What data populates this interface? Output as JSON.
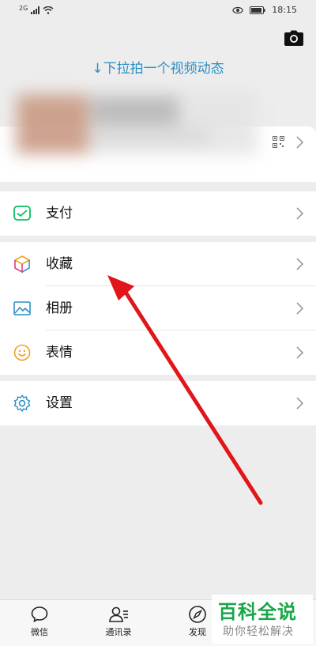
{
  "status_bar": {
    "network": "2G",
    "time": "18:15"
  },
  "header": {
    "pull_hint": "↓下拉拍一个视频动态"
  },
  "menu": {
    "pay": "支付",
    "favorites": "收藏",
    "album": "相册",
    "stickers": "表情",
    "settings": "设置"
  },
  "tabs": [
    {
      "label": "微信"
    },
    {
      "label": "通讯录"
    },
    {
      "label": "发现"
    }
  ],
  "watermark": {
    "title": "百科全说",
    "subtitle": "助你轻松解决"
  },
  "colors": {
    "accent_blue": "#2a8fc4",
    "wechat_green": "#07c160",
    "annotation_red": "#e0161a",
    "background": "#ededed"
  }
}
